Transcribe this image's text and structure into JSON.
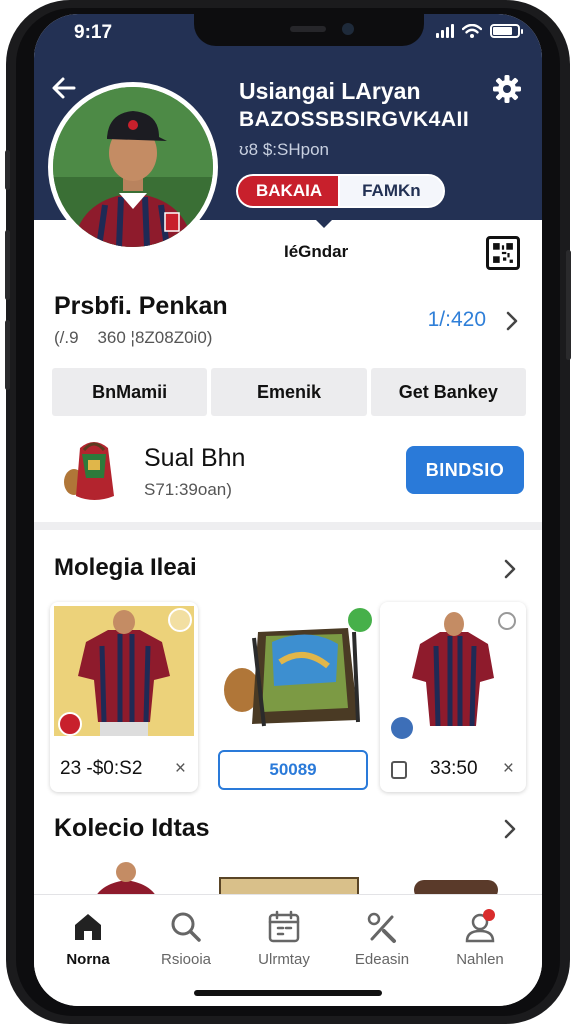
{
  "status_bar": {
    "time": "9:17"
  },
  "header": {
    "back_icon": "back-arrow-icon",
    "settings_icon": "gear-icon",
    "name": "Usiangai LAryan",
    "handle": "BAZOSSBSIRGVK4AII",
    "meta": "ʊ8 $:SHpon",
    "pill_left": "BAKAIA",
    "pill_right": "FAMKn",
    "colors": {
      "header_bg": "#233154",
      "pill_red": "#c8202c"
    }
  },
  "tab": {
    "label": "IéGndar",
    "qr_icon": "qr-code-icon"
  },
  "profile_panel": {
    "title": "Prsbfi. Penkan",
    "subtitle": "(/.9    360 ¦8Z08Z0i0)",
    "points": "1/:420",
    "segments": [
      "BnMamii",
      "Emenik",
      "Get Bankey"
    ]
  },
  "featured_item": {
    "title": "Sual Bhn",
    "subtitle": "S71:39oan)",
    "action_label": "BINDSIO",
    "accent_color": "#2a7ad9"
  },
  "section_1": {
    "title": "Molegia Ileai",
    "cards": [
      {
        "kind": "jersey",
        "price": "23 -$0:S2",
        "close": "×"
      },
      {
        "kind": "bag",
        "action": "50089"
      },
      {
        "kind": "jersey",
        "price": "33:50",
        "close": "×"
      }
    ]
  },
  "section_2": {
    "title": "Kolecio Idtas"
  },
  "bottom_nav": [
    {
      "label": "Norna",
      "icon": "home-icon",
      "active": true
    },
    {
      "label": "Rsiooia",
      "icon": "search-icon",
      "active": false
    },
    {
      "label": "Ulrmtay",
      "icon": "calendar-icon",
      "active": false
    },
    {
      "label": "Edeasin",
      "icon": "tools-icon",
      "active": false
    },
    {
      "label": "Nahlen",
      "icon": "profile-icon",
      "active": false,
      "badge": "!"
    }
  ]
}
